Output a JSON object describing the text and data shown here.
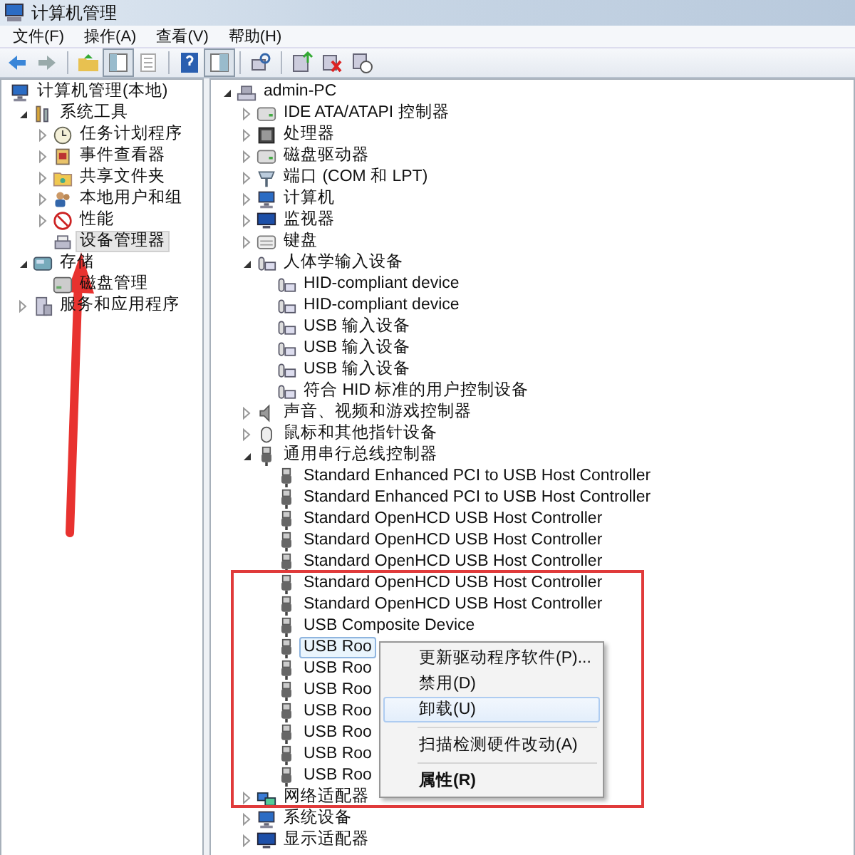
{
  "window": {
    "title": "计算机管理"
  },
  "menu": [
    {
      "label": "文件(F)"
    },
    {
      "label": "操作(A)"
    },
    {
      "label": "查看(V)"
    },
    {
      "label": "帮助(H)"
    }
  ],
  "left_tree": {
    "items": [
      {
        "label": "计算机管理(本地)",
        "kind": "computer",
        "selected": false,
        "children": [
          {
            "label": "系统工具",
            "kind": "tools",
            "selected": false,
            "expanded": true,
            "children": [
              {
                "label": "任务计划程序",
                "kind": "clock",
                "selected": false,
                "expanded": false
              },
              {
                "label": "事件查看器",
                "kind": "log",
                "selected": false,
                "expanded": false
              },
              {
                "label": "共享文件夹",
                "kind": "folder",
                "selected": false,
                "expanded": false
              },
              {
                "label": "本地用户和组",
                "kind": "users",
                "selected": false,
                "expanded": false
              },
              {
                "label": "性能",
                "kind": "perf",
                "selected": false,
                "expanded": false
              },
              {
                "label": "设备管理器",
                "kind": "device",
                "selected": true
              }
            ]
          },
          {
            "label": "存储",
            "kind": "storage",
            "selected": false,
            "expanded": true,
            "children": [
              {
                "label": "磁盘管理",
                "kind": "disk",
                "selected": false
              }
            ]
          },
          {
            "label": "服务和应用程序",
            "kind": "service",
            "selected": false,
            "expanded": false
          }
        ]
      }
    ]
  },
  "right_tree": {
    "items": [
      {
        "label": "admin-PC",
        "kind": "pc",
        "selected": false,
        "expanded": true,
        "children": [
          {
            "label": "IDE ATA/ATAPI 控制器",
            "kind": "drive",
            "selected": false,
            "expanded": false
          },
          {
            "label": "处理器",
            "kind": "cpu",
            "selected": false,
            "expanded": false
          },
          {
            "label": "磁盘驱动器",
            "kind": "drive",
            "selected": false,
            "expanded": false
          },
          {
            "label": "端口 (COM 和 LPT)",
            "kind": "port",
            "selected": false,
            "expanded": false
          },
          {
            "label": "计算机",
            "kind": "computer",
            "selected": false,
            "expanded": false
          },
          {
            "label": "监视器",
            "kind": "monitor",
            "selected": false,
            "expanded": false
          },
          {
            "label": "键盘",
            "kind": "keyboard",
            "selected": false,
            "expanded": false
          },
          {
            "label": "人体学输入设备",
            "kind": "hid",
            "selected": false,
            "expanded": true,
            "children": [
              {
                "label": "HID-compliant device",
                "kind": "hid",
                "selected": false
              },
              {
                "label": "HID-compliant device",
                "kind": "hid",
                "selected": false
              },
              {
                "label": "USB 输入设备",
                "kind": "hid",
                "selected": false
              },
              {
                "label": "USB 输入设备",
                "kind": "hid",
                "selected": false
              },
              {
                "label": "USB 输入设备",
                "kind": "hid",
                "selected": false
              },
              {
                "label": "符合 HID 标准的用户控制设备",
                "kind": "hid",
                "selected": false
              }
            ]
          },
          {
            "label": "声音、视频和游戏控制器",
            "kind": "sound",
            "selected": false,
            "expanded": false
          },
          {
            "label": "鼠标和其他指针设备",
            "kind": "mouse",
            "selected": false,
            "expanded": false
          },
          {
            "label": "通用串行总线控制器",
            "kind": "usb",
            "selected": false,
            "expanded": true,
            "children": [
              {
                "label": "Standard Enhanced PCI to USB Host Controller",
                "kind": "usb",
                "selected": false
              },
              {
                "label": "Standard Enhanced PCI to USB Host Controller",
                "kind": "usb",
                "selected": false
              },
              {
                "label": "Standard OpenHCD USB Host Controller",
                "kind": "usb",
                "selected": false
              },
              {
                "label": "Standard OpenHCD USB Host Controller",
                "kind": "usb",
                "selected": false
              },
              {
                "label": "Standard OpenHCD USB Host Controller",
                "kind": "usb",
                "selected": false
              },
              {
                "label": "Standard OpenHCD USB Host Controller",
                "kind": "usb",
                "selected": false
              },
              {
                "label": "Standard OpenHCD USB Host Controller",
                "kind": "usb",
                "selected": false
              },
              {
                "label": "USB Composite Device",
                "kind": "usb",
                "selected": false
              },
              {
                "label": "USB Roo",
                "kind": "usb",
                "selected": true
              },
              {
                "label": "USB Roo",
                "kind": "usb",
                "selected": false
              },
              {
                "label": "USB Roo",
                "kind": "usb",
                "selected": false
              },
              {
                "label": "USB Roo",
                "kind": "usb",
                "selected": false
              },
              {
                "label": "USB Roo",
                "kind": "usb",
                "selected": false
              },
              {
                "label": "USB Roo",
                "kind": "usb",
                "selected": false
              },
              {
                "label": "USB Roo",
                "kind": "usb",
                "selected": false
              }
            ]
          },
          {
            "label": "网络适配器",
            "kind": "network",
            "selected": false,
            "expanded": false
          },
          {
            "label": "系统设备",
            "kind": "computer",
            "selected": false,
            "expanded": false
          },
          {
            "label": "显示适配器",
            "kind": "monitor",
            "selected": false,
            "expanded": false
          }
        ]
      }
    ]
  },
  "context_menu": {
    "items": [
      {
        "kind": "item",
        "label": "更新驱动程序软件(P)...",
        "selected": false,
        "default": false
      },
      {
        "kind": "item",
        "label": "禁用(D)",
        "selected": false,
        "default": false
      },
      {
        "kind": "item",
        "label": "卸载(U)",
        "selected": true,
        "default": false
      },
      {
        "kind": "separator"
      },
      {
        "kind": "item",
        "label": "扫描检测硬件改动(A)",
        "selected": false,
        "default": false
      },
      {
        "kind": "separator"
      },
      {
        "kind": "item",
        "label": "属性(R)",
        "selected": false,
        "default": true
      }
    ]
  }
}
